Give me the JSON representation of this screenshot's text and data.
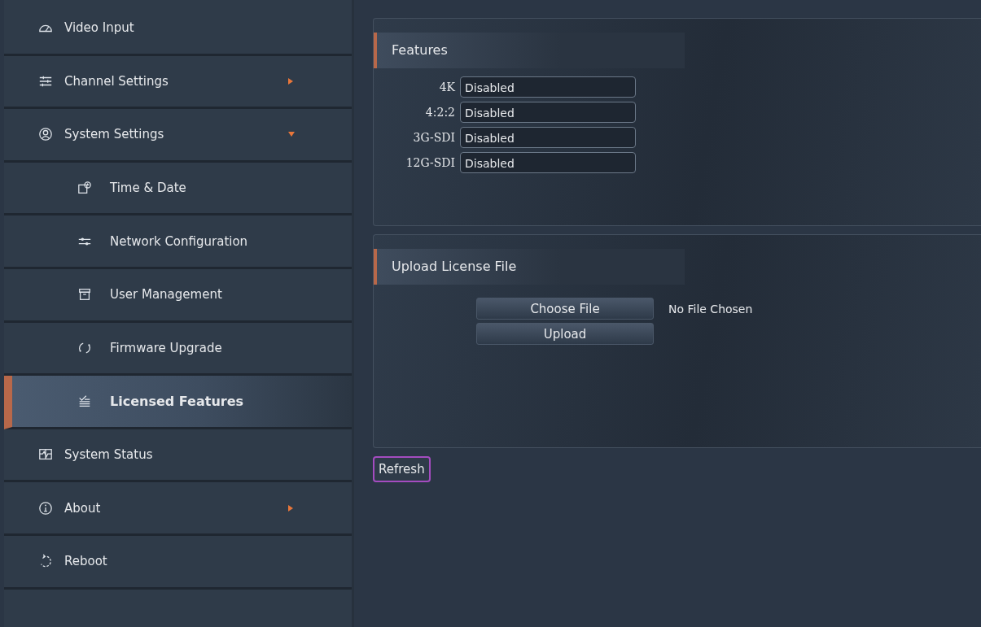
{
  "sidebar": {
    "items": [
      {
        "label": "Video Input",
        "selected": false
      },
      {
        "label": "Channel Settings",
        "selected": false,
        "expanded": false
      },
      {
        "label": "System Settings",
        "selected": false,
        "expanded": true,
        "children": [
          {
            "label": "Time & Date",
            "selected": false
          },
          {
            "label": "Network Configuration",
            "selected": false
          },
          {
            "label": "User Management",
            "selected": false
          },
          {
            "label": "Firmware Upgrade",
            "selected": false
          },
          {
            "label": "Licensed Features",
            "selected": true
          }
        ]
      },
      {
        "label": "System Status",
        "selected": false
      },
      {
        "label": "About",
        "selected": false,
        "expanded": false
      },
      {
        "label": "Reboot",
        "selected": false
      }
    ]
  },
  "features": {
    "title": "Features",
    "rows": [
      {
        "label": "4K",
        "value": "Disabled"
      },
      {
        "label": "4:2:2",
        "value": "Disabled"
      },
      {
        "label": "3G-SDI",
        "value": "Disabled"
      },
      {
        "label": "12G-SDI",
        "value": "Disabled"
      }
    ]
  },
  "upload": {
    "title": "Upload License File",
    "choose_button": "Choose File",
    "file_status": "No File Chosen",
    "upload_button": "Upload"
  },
  "refresh_button": "Refresh"
}
